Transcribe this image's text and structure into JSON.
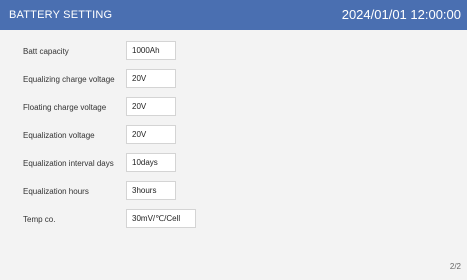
{
  "header": {
    "title": "BATTERY SETTING",
    "datetime": "2024/01/01 12:00:00",
    "color": "#4a6fb1"
  },
  "settings": [
    {
      "label": "Batt capacity",
      "value": "1000Ah"
    },
    {
      "label": "Equalizing charge voltage",
      "value": "20V"
    },
    {
      "label": "Floating charge voltage",
      "value": "20V"
    },
    {
      "label": "Equalization voltage",
      "value": "20V"
    },
    {
      "label": "Equalization interval days",
      "value": "10days"
    },
    {
      "label": "Equalization hours",
      "value": "3hours"
    },
    {
      "label": "Temp co.",
      "value": "30mV/℃/Cell"
    }
  ],
  "pagination": {
    "text": "2/2"
  }
}
